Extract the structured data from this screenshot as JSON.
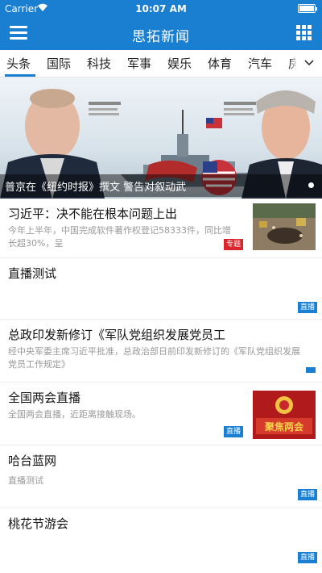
{
  "status_bar": {
    "carrier": "Carrier",
    "time": "10:07 AM",
    "battery_level": 1.0
  },
  "nav": {
    "title": "思拓新闻",
    "menu_icon": "hamburger-menu-icon",
    "grid_icon": "grid-apps-icon"
  },
  "tabs": [
    {
      "label": "头条",
      "active": true
    },
    {
      "label": "国际"
    },
    {
      "label": "科技"
    },
    {
      "label": "军事"
    },
    {
      "label": "娱乐"
    },
    {
      "label": "体育"
    },
    {
      "label": "汽车"
    },
    {
      "label": "房"
    }
  ],
  "banner": {
    "caption": "普京在《纽约时报》撰文 警告对叙动武",
    "page_count": 1,
    "active_page": 1
  },
  "news": [
    {
      "title": "习近平：决不能在根本问题上出",
      "summary": [
        "今年上半年，中国完成软件著作权登记58333件，同比增",
        "长超30%，呈"
      ],
      "badge": "专题",
      "badge_color": "#d9262c",
      "has_thumb": true
    },
    {
      "title": "直播测试",
      "summary": [],
      "badge": "直播",
      "badge_color": "#1a7fd1",
      "has_thumb": false
    },
    {
      "title": "总政印发新修订《军队党组织发展党员工",
      "summary": [
        "经中央军委主席习近平批准，总政治部日前印发新修订的《军队党组织发展",
        "党员工作规定》"
      ],
      "badge": "",
      "badge_color": "#1a7fd1",
      "has_thumb": false
    },
    {
      "title": "全国两会直播",
      "summary": [
        "全国两会直播，近距离接触现场。"
      ],
      "badge": "直播",
      "badge_color": "#1a7fd1",
      "has_thumb": true,
      "thumb_text": "聚焦两会"
    },
    {
      "title": "哈台蓝网",
      "summary": [
        "直播测试"
      ],
      "badge": "直播",
      "badge_color": "#1a7fd1",
      "has_thumb": false
    },
    {
      "title": "桃花节游会",
      "summary": [],
      "badge": "直播",
      "badge_color": "#1a7fd1",
      "has_thumb": false
    }
  ]
}
